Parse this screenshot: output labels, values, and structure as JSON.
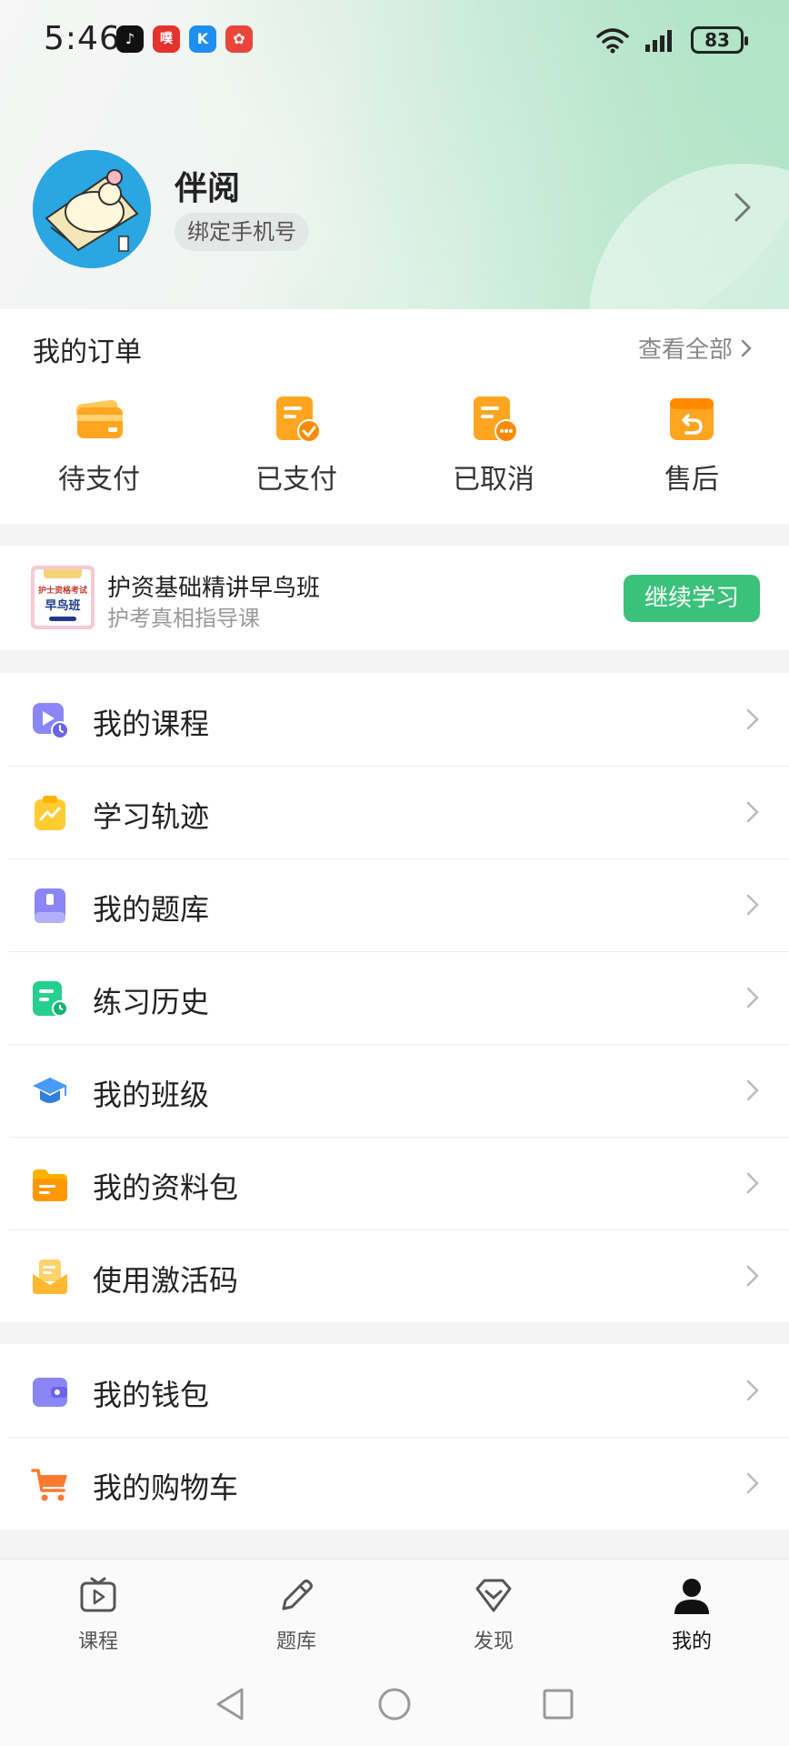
{
  "status_bar": {
    "time": "5:46",
    "apps": [
      {
        "name": "tiktok-icon",
        "glyph": "♪",
        "color": "#111111"
      },
      {
        "name": "app-red-icon",
        "glyph": "噗",
        "color": "#e5322f"
      },
      {
        "name": "app-blue-icon",
        "glyph": "K",
        "color": "#1e8ff0"
      },
      {
        "name": "app-gift-icon",
        "glyph": "✿",
        "color": "#e8463a"
      }
    ],
    "battery": "83"
  },
  "profile": {
    "name": "伴阅",
    "bind_phone": "绑定手机号"
  },
  "orders": {
    "title": "我的订单",
    "view_all": "查看全部",
    "items": [
      {
        "label": "待支付",
        "icon": "wallet-icon"
      },
      {
        "label": "已支付",
        "icon": "paid-doc-icon"
      },
      {
        "label": "已取消",
        "icon": "cancelled-doc-icon"
      },
      {
        "label": "售后",
        "icon": "return-box-icon"
      }
    ]
  },
  "course_card": {
    "thumb_line1": "护士资格考试",
    "thumb_line2": "早鸟班",
    "title": "护资基础精讲早鸟班",
    "subtitle": "护考真相指导课",
    "button": "继续学习"
  },
  "menu_group1": [
    {
      "label": "我的课程",
      "icon": "video-course-icon"
    },
    {
      "label": "学习轨迹",
      "icon": "trend-clipboard-icon"
    },
    {
      "label": "我的题库",
      "icon": "question-bank-icon"
    },
    {
      "label": "练习历史",
      "icon": "practice-history-icon"
    },
    {
      "label": "我的班级",
      "icon": "graduation-cap-icon"
    },
    {
      "label": "我的资料包",
      "icon": "folder-icon"
    },
    {
      "label": "使用激活码",
      "icon": "envelope-code-icon"
    }
  ],
  "menu_group2": [
    {
      "label": "我的钱包",
      "icon": "wallet-purple-icon"
    },
    {
      "label": "我的购物车",
      "icon": "cart-icon"
    }
  ],
  "tabbar": [
    {
      "label": "课程",
      "icon": "tv-play-icon"
    },
    {
      "label": "题库",
      "icon": "pencil-icon"
    },
    {
      "label": "发现",
      "icon": "diamond-icon"
    },
    {
      "label": "我的",
      "icon": "person-icon",
      "active": true
    }
  ],
  "colors": {
    "accent_green": "#3cc17b",
    "order_orange": "#ffa51f"
  }
}
